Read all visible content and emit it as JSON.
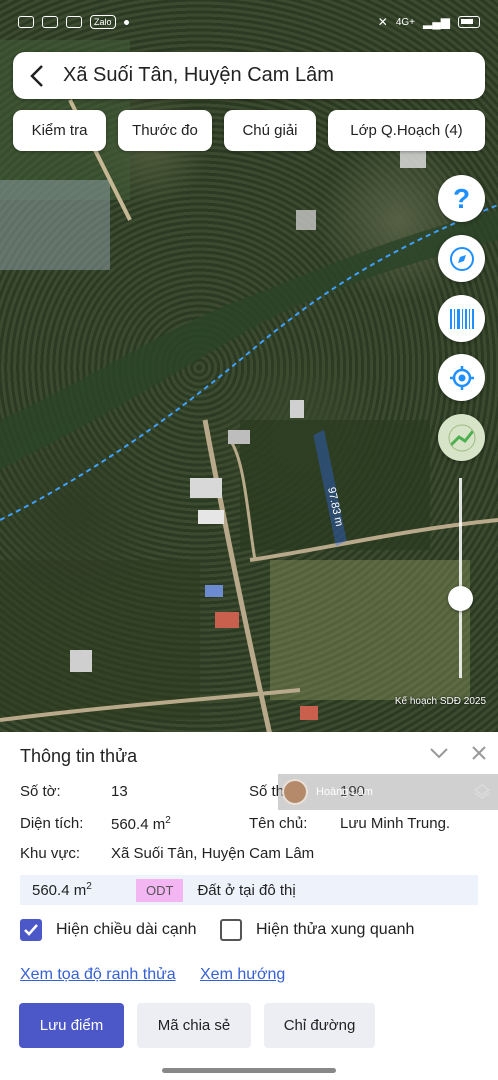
{
  "status_bar": {
    "zalo": "Zalo",
    "network": "4G+"
  },
  "header": {
    "title": "Xã Suối Tân, Huyện Cam Lâm"
  },
  "chips": [
    {
      "label": "Kiểm tra"
    },
    {
      "label": "Thước đo"
    },
    {
      "label": "Chú giải"
    },
    {
      "label": "Lớp Q.Hoạch (4)"
    }
  ],
  "map": {
    "measure_label": "97.83 m",
    "attribution": "Kế hoạch SDĐ 2025",
    "fab_icons": [
      "help-icon",
      "compass-icon",
      "barcode-icon",
      "my-location-icon",
      "map-layer-icon"
    ],
    "parcel_color": "#2f6bff"
  },
  "parcel": {
    "title": "Thông tin thửa",
    "so_to_label": "Số tờ:",
    "so_to": "13",
    "so_thua_label": "Số th",
    "so_thua": "190",
    "dien_tich_label": "Diện tích:",
    "dien_tich": "560.4 m",
    "ten_chu_label": "Tên chủ:",
    "ten_chu": "Lưu Minh Trung.",
    "khu_vuc_label": "Khu vực:",
    "khu_vuc": "Xã Suối Tân, Huyện Cam Lâm",
    "land_area": "560.4 m",
    "land_code": "ODT",
    "land_type": "Đất ở tại đô thị"
  },
  "options": {
    "show_edges": "Hiện chiều dài cạnh",
    "show_edges_checked": true,
    "show_neighbors": "Hiện thửa xung quanh",
    "show_neighbors_checked": false
  },
  "links": {
    "coords": "Xem tọa độ ranh thửa",
    "direction": "Xem hướng"
  },
  "actions": {
    "save": "Lưu điểm",
    "share": "Mã chia sẻ",
    "route": "Chỉ đường"
  },
  "overlay": {
    "user": "Hoàng Lâm"
  },
  "colors": {
    "primary": "#4c58c8",
    "link": "#3561d4",
    "odt": "#f3b6f3"
  }
}
